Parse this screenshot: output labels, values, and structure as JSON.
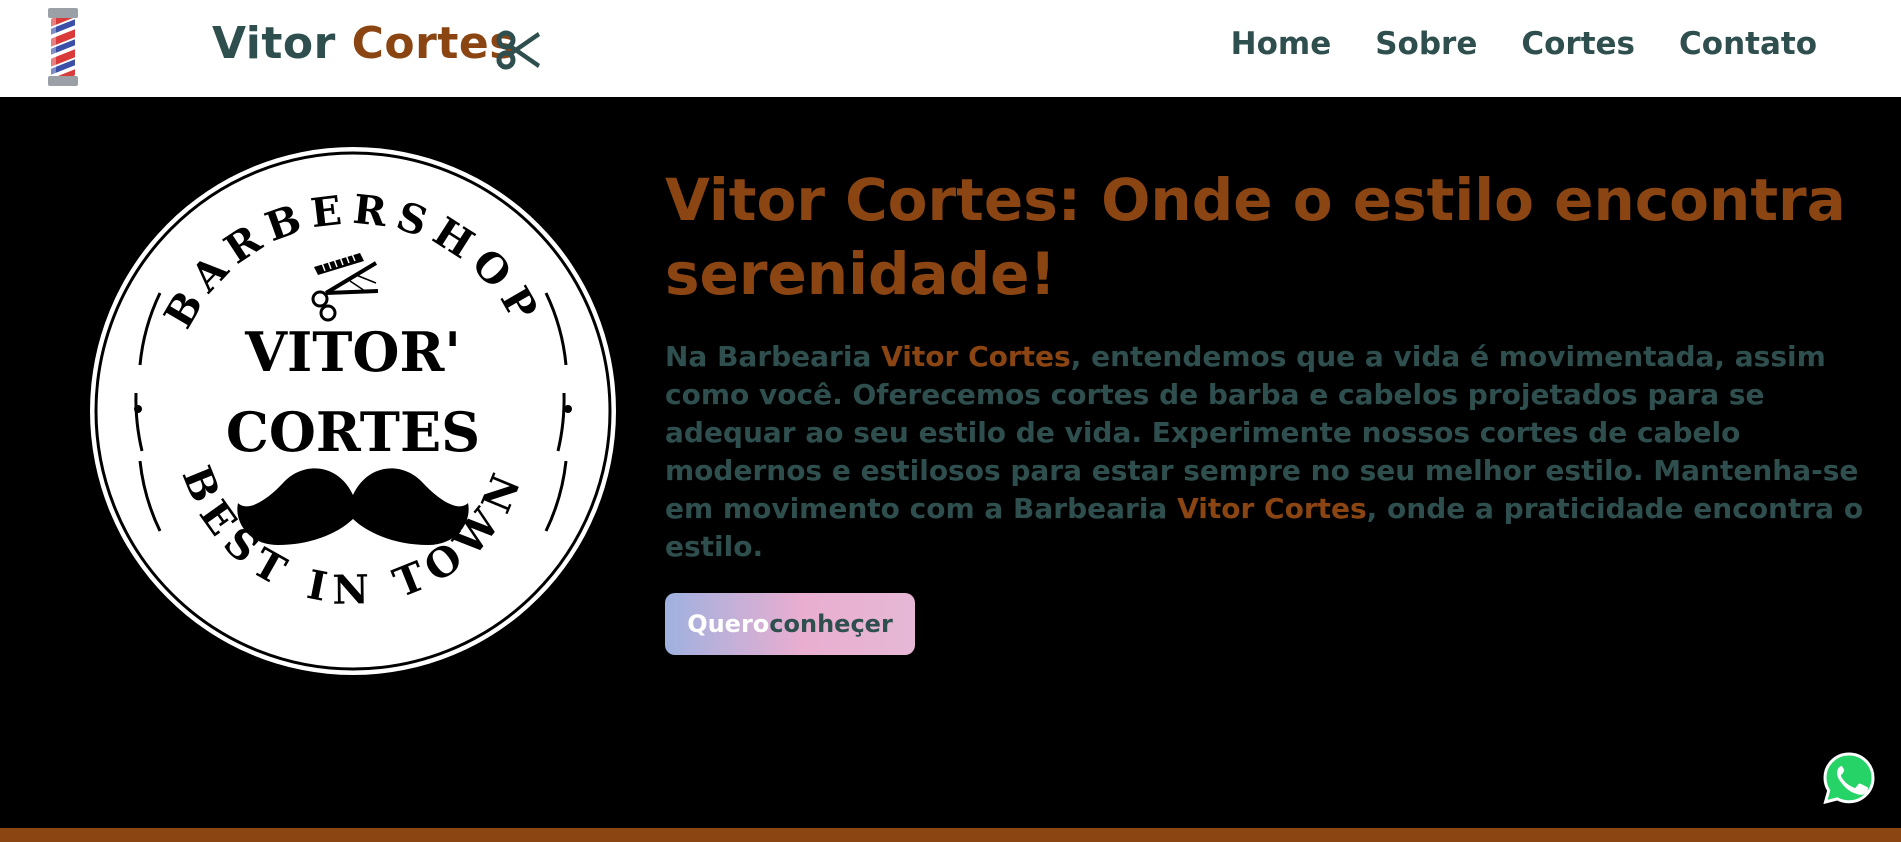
{
  "header": {
    "brand_part1": "Vitor ",
    "brand_part2": "Cortes",
    "nav": [
      "Home",
      "Sobre",
      "Cortes",
      "Contato"
    ]
  },
  "hero": {
    "logo": {
      "arc_top": "BARBERSHOP",
      "name_line1": "VITOR'",
      "name_line2": "CORTES",
      "arc_bottom": "BEST IN TOWN"
    },
    "headline": "Vitor Cortes: Onde o estilo encontra serenidade!",
    "paragraph": {
      "p1": "Na Barbearia ",
      "h1": "Vitor Cortes",
      "p2": ", entendemos que a vida é movimentada, assim como você. Oferecemos cortes de barba e cabelos projetados para se adequar ao seu estilo de vida. Experimente nossos cortes de cabelo modernos e estilosos para estar sempre no seu melhor estilo. Mantenha-se em movimento com a Barbearia ",
      "h2": "Vitor Cortes",
      "p3": ", onde a praticidade encontra o estilo."
    },
    "cta": {
      "word1": "Quero",
      "word2": "conheçer"
    }
  },
  "icons": {
    "pole": "barber-pole-icon",
    "scissors": "scissors-icon",
    "whatsapp": "whatsapp-icon"
  },
  "colors": {
    "brand_brown": "#8b4513",
    "brand_slate": "#2f4f4f",
    "hero_background": "#000000",
    "whatsapp_green": "#25d366"
  }
}
